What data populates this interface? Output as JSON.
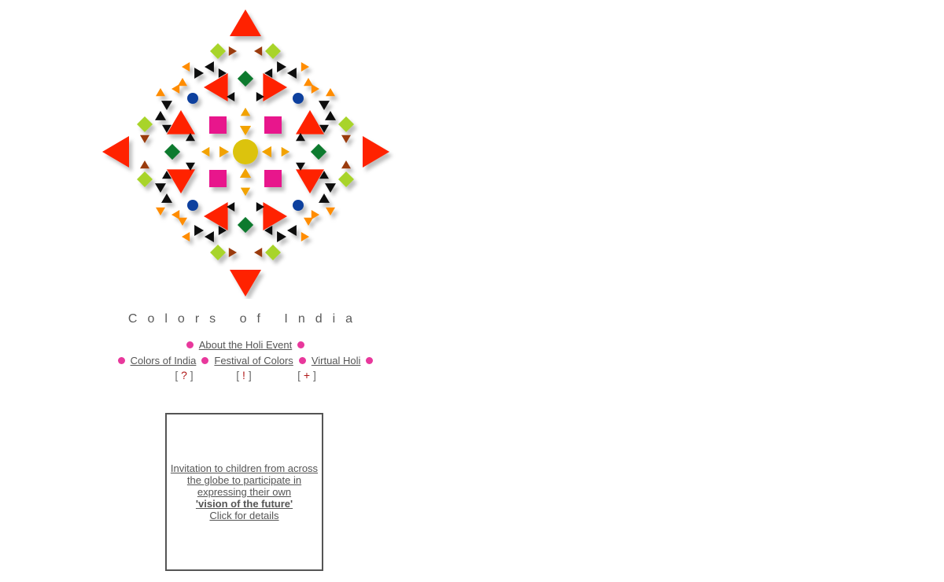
{
  "site": {
    "title": "Colors of India"
  },
  "nav": {
    "about_link": "About the Holi Event",
    "colors_link": "Colors of India",
    "festival_link": "Festival of Colors",
    "virtual_link": "Virtual Holi",
    "bracket_help": "?",
    "bracket_info": "!",
    "bracket_more": "+"
  },
  "promo": {
    "line1": "Invitation to children from across the globe to participate in expressing their own",
    "emphasis": "'vision of the future'",
    "cta": "Click for details"
  },
  "colors": {
    "red": "#ff2200",
    "magenta": "#e8138c",
    "green": "#0f7a2e",
    "lime": "#a8d42a",
    "blue": "#0c3f9e",
    "yellow": "#dcc30a",
    "orange": "#ff8c00",
    "gold": "#f2a200",
    "brown": "#9a3a0a",
    "black": "#111111",
    "dot": "#e8389c",
    "link": "#555555",
    "bracket_symbol": "#b01818"
  }
}
